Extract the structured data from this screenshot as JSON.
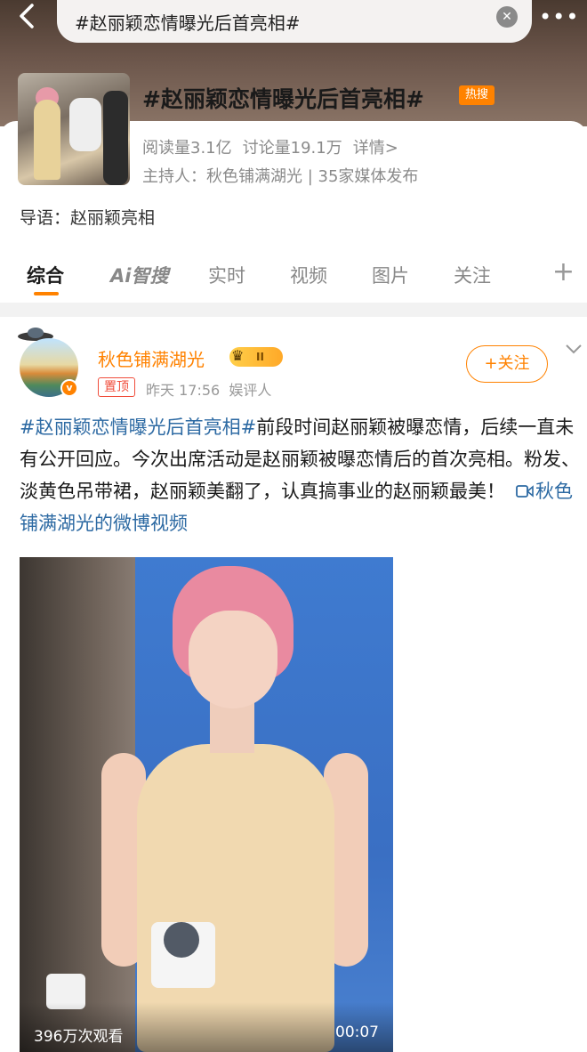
{
  "search": {
    "query": "#赵丽颖恋情曝光后首亮相#",
    "clear_glyph": "✕",
    "more_glyph": "•••"
  },
  "topic": {
    "title": "#赵丽颖恋情曝光后首亮相#",
    "hot_badge": "热搜",
    "reads": "阅读量3.1亿",
    "discussions": "讨论量19.1万",
    "details": "详情>",
    "host": "主持人：秋色铺满湖光 | 35家媒体发布",
    "guide": "导语：赵丽颖亮相"
  },
  "tabs": [
    {
      "label": "综合",
      "active": true
    },
    {
      "label": "Ai智搜",
      "active": false
    },
    {
      "label": "实时",
      "active": false
    },
    {
      "label": "视频",
      "active": false
    },
    {
      "label": "图片",
      "active": false
    },
    {
      "label": "关注",
      "active": false
    }
  ],
  "tab_plus": "+",
  "post": {
    "author": "秋色铺满湖光",
    "rank": "II",
    "pin": "置顶",
    "time": "昨天 17:56",
    "source": "娱评人",
    "follow": "+关注",
    "hashtag": "#赵丽颖恋情曝光后首亮相#",
    "text": "前段时间赵丽颖被曝恋情，后续一直未有公开回应。今次出席活动是赵丽颖被曝恋情后的首次亮相。粉发、淡黄色吊带裙，赵丽颖美翻了，认真搞事业的赵丽颖最美！",
    "video_link": "秋色铺满湖光的微博视频",
    "verified_glyph": "v"
  },
  "video": {
    "views": "396万次观看",
    "duration": "00:07"
  },
  "colors": {
    "accent": "#ff8200",
    "link": "#2d6aa3",
    "pin": "#f04d3b"
  }
}
